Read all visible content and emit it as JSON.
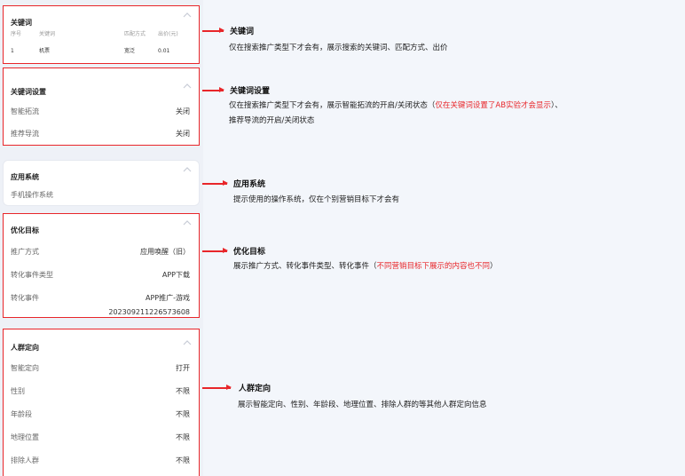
{
  "panels": {
    "keyword": {
      "title": "关键词",
      "headers": [
        "序号",
        "关键词",
        "匹配方式",
        "出价(元)"
      ],
      "row": [
        "1",
        "机票",
        "宽泛",
        "0.01"
      ]
    },
    "keyword_settings": {
      "title": "关键词设置",
      "rows": [
        {
          "key": "智能拓流",
          "value": "关闭"
        },
        {
          "key": "推荐导流",
          "value": "关闭"
        }
      ]
    },
    "app_system": {
      "title": "应用系统",
      "rows": [
        {
          "key": "手机操作系统",
          "value": ""
        }
      ]
    },
    "optimization": {
      "title": "优化目标",
      "rows": [
        {
          "key": "推广方式",
          "value": "应用唤醒（旧）"
        },
        {
          "key": "转化事件类型",
          "value": "APP下载"
        },
        {
          "key": "转化事件",
          "value": "APP推广-游戏"
        }
      ],
      "extra_line": "20230921122657360‌8"
    },
    "audience": {
      "title": "人群定向",
      "rows": [
        {
          "key": "智能定向",
          "value": "打开"
        },
        {
          "key": "性别",
          "value": "不限"
        },
        {
          "key": "年龄段",
          "value": "不限"
        },
        {
          "key": "地理位置",
          "value": "不限"
        },
        {
          "key": "排除人群",
          "value": "不限"
        }
      ]
    }
  },
  "annotations": {
    "keyword": {
      "title": "关键词",
      "body": "仅在搜索推广类型下才会有，展示搜索的关键词、匹配方式、出价"
    },
    "keyword_settings": {
      "title": "关键词设置",
      "body_1": "仅在搜索推广类型下才会有，展示智能拓流的开启/关闭状态（",
      "body_red": "仅在关键词设置了AB实验才会显示",
      "body_2": "）、",
      "body_line2": "推荐导流的开启/关闭状态"
    },
    "app_system": {
      "title": "应用系统",
      "body": "提示使用的操作系统，仅在个别营销目标下才会有"
    },
    "optimization": {
      "title": "优化目标",
      "body_1": "展示推广方式、转化事件类型、转化事件（",
      "body_red": "不同营销目标下展示的内容也不同",
      "body_2": "）"
    },
    "audience": {
      "title": "人群定向",
      "body": "展示智能定向、性别、年龄段、地理位置、排除人群的等其他人群定向信息"
    }
  },
  "colors": {
    "highlight": "#e8262a",
    "chevron": "#c8ccd6"
  },
  "icons": {
    "collapse": "chevron-up-icon"
  }
}
